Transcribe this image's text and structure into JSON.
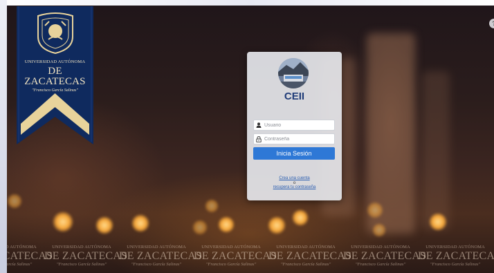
{
  "university": {
    "line1": "UNIVERSIDAD AUTÓNOMA",
    "line2": "DE ZACATECAS",
    "line3": "\"Francisco García Salinas\""
  },
  "watermark": {
    "line1": "UNIVERSIDAD AUTÓNOMA",
    "line2": "DE ZACATECAS",
    "line3": "\"Francisco García Salinas\""
  },
  "login": {
    "title": "CEII",
    "username_placeholder": "Usuario",
    "password_placeholder": "Contraseña",
    "login_button": "Inicia Sesión",
    "create_account_link": "Crea una cuenta",
    "or_text": "o",
    "recover_password_link": "recupera tu contraseña"
  },
  "icons": {
    "help": "question-icon",
    "username": "user-icon",
    "password": "lock-icon"
  },
  "help_glyph": "?",
  "colors": {
    "banner_blue": "#0f2a5e",
    "banner_gold": "#e8d39b",
    "title_blue": "#1f3b78",
    "button_blue": "#2e78d6",
    "link_blue": "#2a5db0"
  }
}
